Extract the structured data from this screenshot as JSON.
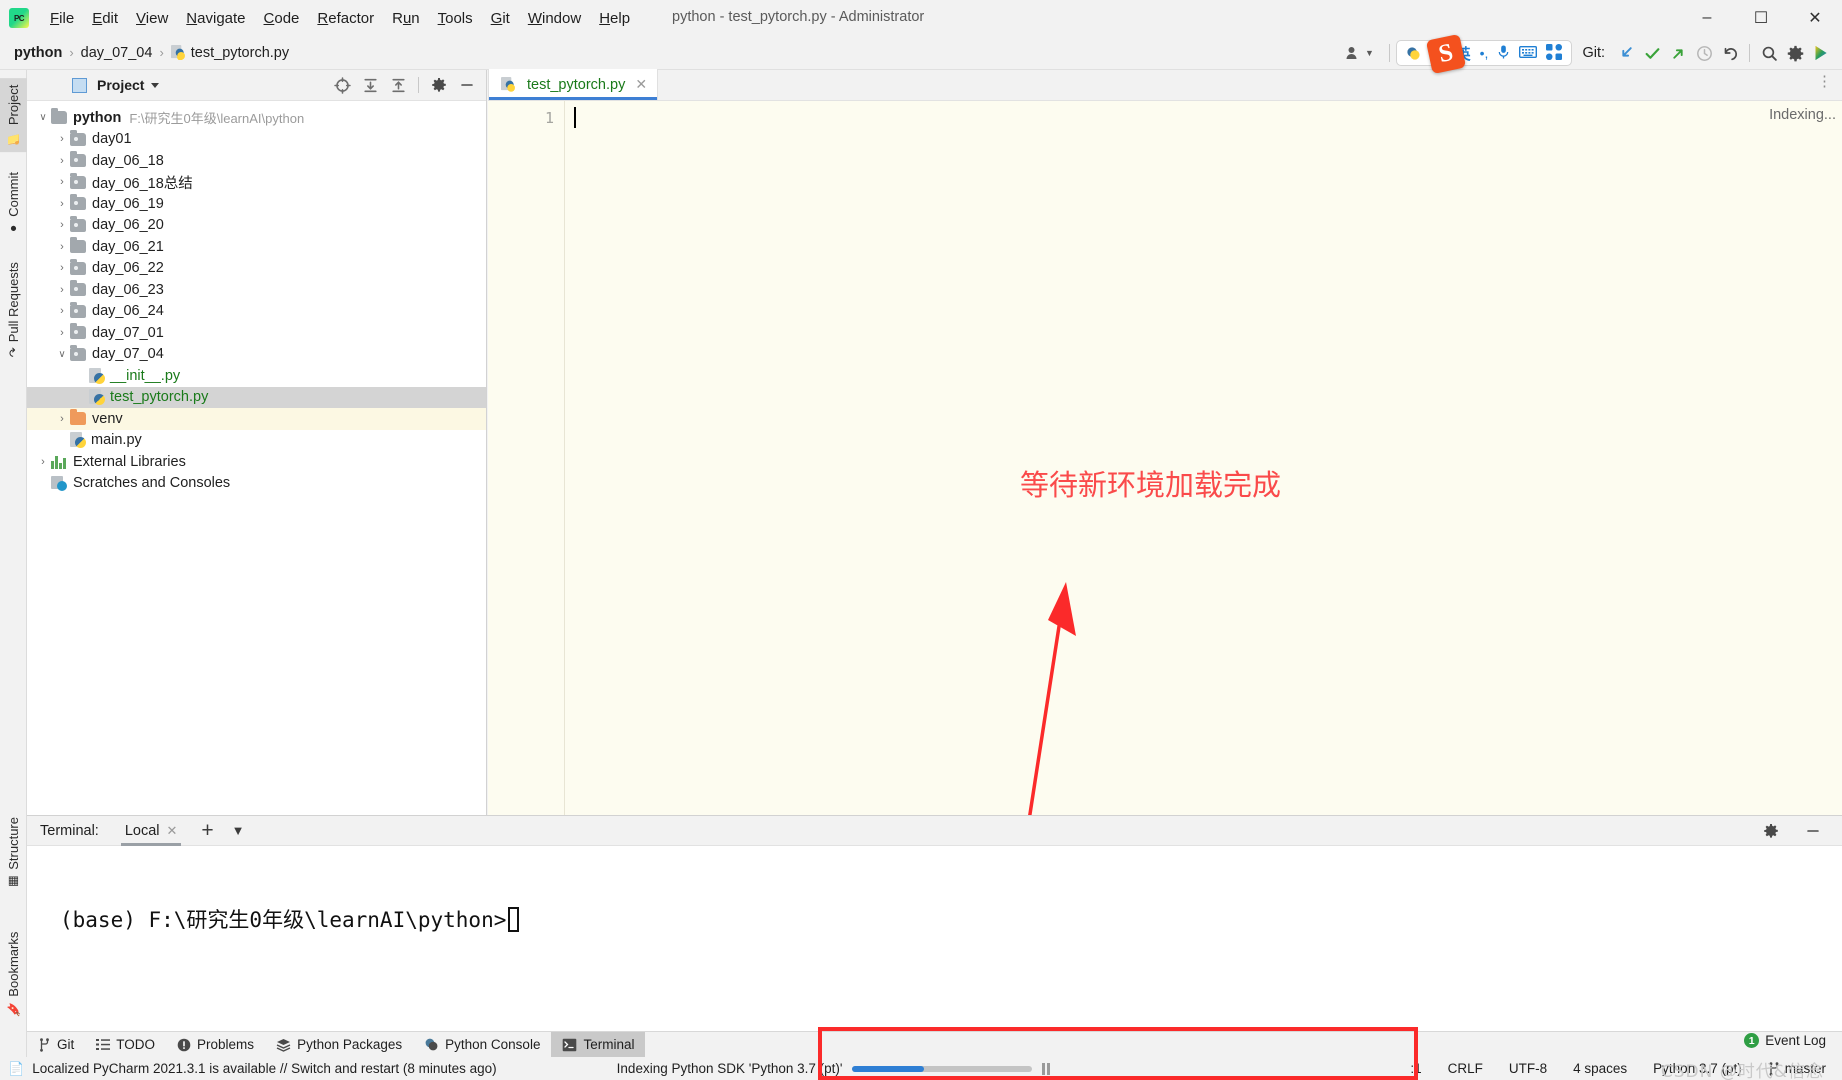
{
  "window": {
    "title": "python - test_pytorch.py - Administrator",
    "app_logo": "pycharm-logo",
    "minimize": "–",
    "maximize": "❐",
    "close": "✕"
  },
  "menubar": {
    "items": [
      {
        "label": "File",
        "mnemonic": "F"
      },
      {
        "label": "Edit",
        "mnemonic": "E"
      },
      {
        "label": "View",
        "mnemonic": "V"
      },
      {
        "label": "Navigate",
        "mnemonic": "N"
      },
      {
        "label": "Code",
        "mnemonic": "C"
      },
      {
        "label": "Refactor",
        "mnemonic": "R"
      },
      {
        "label": "Run",
        "mnemonic": "u"
      },
      {
        "label": "Tools",
        "mnemonic": "T"
      },
      {
        "label": "Git",
        "mnemonic": "G"
      },
      {
        "label": "Window",
        "mnemonic": "W"
      },
      {
        "label": "Help",
        "mnemonic": "H"
      }
    ]
  },
  "navbar": {
    "breadcrumbs": [
      "python",
      "day_07_04",
      "test_pytorch.py"
    ],
    "separator": "›",
    "run_config": "te",
    "git_label": "Git:",
    "ime": {
      "sogou_logo": "S",
      "language": "英",
      "punctuation": "•,",
      "mic": "microphone-icon",
      "keyboard": "keyboard-icon",
      "apps": "toolbox-icon"
    },
    "git_actions": [
      "update-project",
      "commit",
      "push",
      "history",
      "rollback"
    ],
    "right_actions": [
      "search-everywhere",
      "settings",
      "run-anything"
    ]
  },
  "left_toolstrip": {
    "top": [
      {
        "label": "Project",
        "icon": "project-folder-icon",
        "active": true
      },
      {
        "label": "Commit",
        "icon": "commit-icon",
        "active": false
      },
      {
        "label": "Pull Requests",
        "icon": "pull-request-icon",
        "active": false
      }
    ],
    "bottom": [
      {
        "label": "Structure",
        "icon": "structure-icon"
      },
      {
        "label": "Bookmarks",
        "icon": "bookmark-icon"
      }
    ]
  },
  "project_panel": {
    "title": "Project",
    "toolbar": [
      "select-opened-file-icon",
      "expand-all-icon",
      "collapse-all-icon",
      "settings-gear-icon",
      "hide-icon"
    ],
    "tree": [
      {
        "depth": 0,
        "arrow": "down",
        "icon": "folder",
        "label": "python",
        "bold": true,
        "path": "F:\\研究生0年级\\learnAI\\python"
      },
      {
        "depth": 1,
        "arrow": "right",
        "icon": "folder-src",
        "label": "day01"
      },
      {
        "depth": 1,
        "arrow": "right",
        "icon": "folder-src",
        "label": "day_06_18"
      },
      {
        "depth": 1,
        "arrow": "right",
        "icon": "folder-src",
        "label": "day_06_18总结"
      },
      {
        "depth": 1,
        "arrow": "right",
        "icon": "folder-src",
        "label": "day_06_19"
      },
      {
        "depth": 1,
        "arrow": "right",
        "icon": "folder-src",
        "label": "day_06_20"
      },
      {
        "depth": 1,
        "arrow": "right",
        "icon": "folder",
        "label": "day_06_21"
      },
      {
        "depth": 1,
        "arrow": "right",
        "icon": "folder-src",
        "label": "day_06_22"
      },
      {
        "depth": 1,
        "arrow": "right",
        "icon": "folder-src",
        "label": "day_06_23"
      },
      {
        "depth": 1,
        "arrow": "right",
        "icon": "folder-src",
        "label": "day_06_24"
      },
      {
        "depth": 1,
        "arrow": "right",
        "icon": "folder-src",
        "label": "day_07_01"
      },
      {
        "depth": 1,
        "arrow": "down",
        "icon": "folder-src",
        "label": "day_07_04"
      },
      {
        "depth": 2,
        "arrow": "none",
        "icon": "python-file",
        "label": "__init__.py",
        "green": true
      },
      {
        "depth": 2,
        "arrow": "none",
        "icon": "python-file",
        "label": "test_pytorch.py",
        "green": true,
        "selected": true
      },
      {
        "depth": 1,
        "arrow": "right",
        "icon": "folder-excluded",
        "label": "venv",
        "highlight": true
      },
      {
        "depth": 1,
        "arrow": "none",
        "icon": "python-file",
        "label": "main.py"
      },
      {
        "depth": 0,
        "arrow": "right",
        "icon": "libraries",
        "label": "External Libraries"
      },
      {
        "depth": 0,
        "arrow": "none",
        "icon": "scratches",
        "label": "Scratches and Consoles"
      }
    ]
  },
  "editor": {
    "tabs": [
      {
        "label": "test_pytorch.py",
        "icon": "python-file-icon",
        "active": true,
        "close": "✕"
      }
    ],
    "line_numbers": [
      "1"
    ],
    "content": "",
    "indexing_chip": "Indexing...",
    "annotation": "等待新环境加载完成",
    "annotation_color": "#fa4a4a"
  },
  "terminal": {
    "label": "Terminal:",
    "tabs": [
      {
        "label": "Local",
        "close": "✕",
        "active": true
      }
    ],
    "add": "+",
    "dropdown": "∨",
    "right_actions": [
      "settings-gear-icon",
      "hide-icon"
    ],
    "prompt_line": "(base) F:\\研究生0年级\\learnAI\\python>"
  },
  "toolwindow_bar": {
    "items": [
      {
        "label": "Git",
        "icon": "git-branch-icon",
        "active": false
      },
      {
        "label": "TODO",
        "icon": "todo-list-icon",
        "active": false
      },
      {
        "label": "Problems",
        "icon": "problems-icon",
        "active": false
      },
      {
        "label": "Python Packages",
        "icon": "packages-icon",
        "active": false
      },
      {
        "label": "Python Console",
        "icon": "python-console-icon",
        "active": false
      },
      {
        "label": "Terminal",
        "icon": "terminal-icon",
        "active": true
      }
    ],
    "event_log": {
      "label": "Event Log",
      "count": "1"
    }
  },
  "status_bar": {
    "notification": "Localized PyCharm 2021.3.1 is available // Switch and restart (8 minutes ago)",
    "progress_text": "Indexing Python SDK 'Python 3.7 (pt)'",
    "progress_percent": 40,
    "pause": "pause-icon",
    "caret_position": ":1",
    "line_separator": "CRLF",
    "encoding": "UTF-8",
    "indent": "4 spaces",
    "interpreter": "Python 3.7 (pt)",
    "branch": "master",
    "watermark": "CSDN @时代&信念"
  },
  "colors": {
    "accent_blue": "#2f7fd4",
    "tab_underline": "#3e7fd4",
    "annotation_red": "#fb2a2a",
    "python_green": "#1a7a1a",
    "editor_bg": "#fdfcf0",
    "panel_bg": "#f2f2f2",
    "selection_gray": "#d4d4d4",
    "highlight_yellow": "#fcf8e3"
  }
}
